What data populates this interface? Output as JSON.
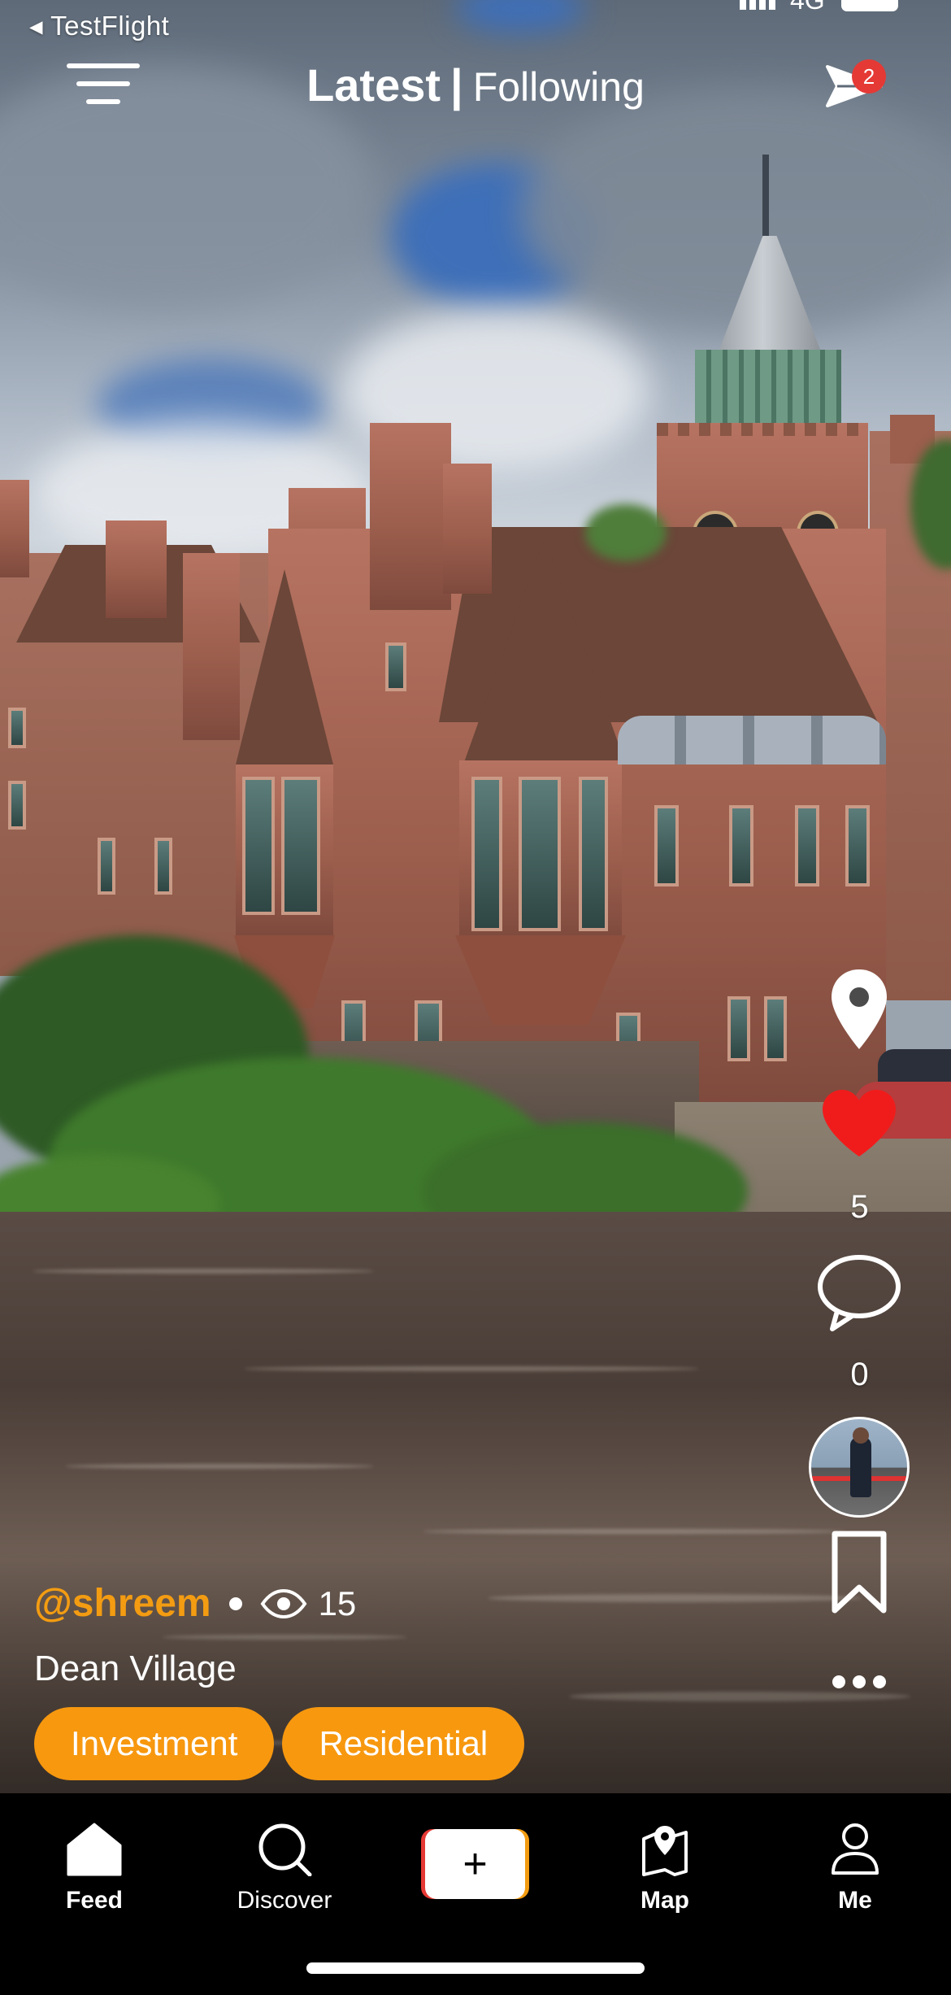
{
  "status_bar": {
    "back_app": "◂ TestFlight",
    "network": "4G"
  },
  "header": {
    "tab_latest": "Latest",
    "separator": "|",
    "tab_following": "Following",
    "inbox_badge": "2"
  },
  "rail": {
    "likes": "5",
    "comments": "0"
  },
  "post": {
    "username": "@shreem",
    "views": "15",
    "location": "Dean Village",
    "tags": [
      "Investment",
      "Residential"
    ]
  },
  "nav": {
    "feed": "Feed",
    "discover": "Discover",
    "add": "+",
    "map": "Map",
    "me": "Me"
  },
  "colors": {
    "accent": "#f7980f",
    "username": "#f39c12",
    "like_red": "#e53935",
    "badge_red": "#e53935"
  }
}
